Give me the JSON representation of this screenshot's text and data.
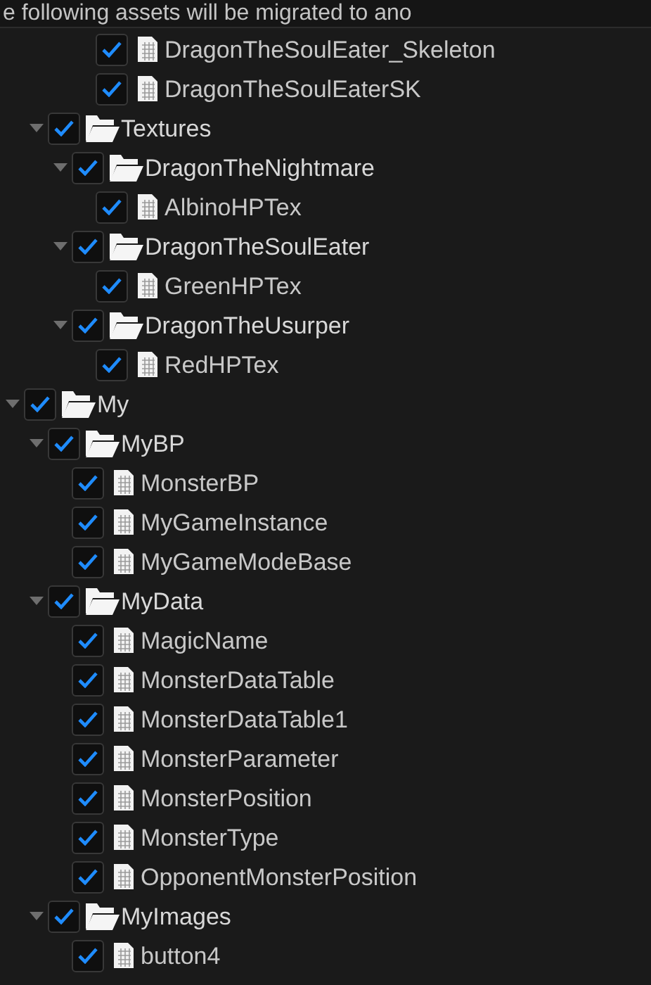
{
  "header": {
    "text": "e following assets will be migrated to ano"
  },
  "tree": [
    {
      "kind": "offscreen",
      "children": [
        {
          "kind": "offscreen",
          "children": [
            {
              "kind": "offscreen",
              "children": [
                {
                  "kind": "file",
                  "label": "DragonTheSoulEater_Skeleton",
                  "checked": true
                },
                {
                  "kind": "file",
                  "label": "DragonTheSoulEaterSK",
                  "checked": true
                }
              ]
            }
          ]
        },
        {
          "kind": "folder",
          "label": "Textures",
          "checked": true,
          "expanded": true,
          "children": [
            {
              "kind": "folder",
              "label": "DragonTheNightmare",
              "checked": true,
              "expanded": true,
              "children": [
                {
                  "kind": "file",
                  "label": "AlbinoHPTex",
                  "checked": true
                }
              ]
            },
            {
              "kind": "folder",
              "label": "DragonTheSoulEater",
              "checked": true,
              "expanded": true,
              "children": [
                {
                  "kind": "file",
                  "label": "GreenHPTex",
                  "checked": true
                }
              ]
            },
            {
              "kind": "folder",
              "label": "DragonTheUsurper",
              "checked": true,
              "expanded": true,
              "children": [
                {
                  "kind": "file",
                  "label": "RedHPTex",
                  "checked": true
                }
              ]
            }
          ]
        }
      ]
    },
    {
      "kind": "folder",
      "label": "My",
      "checked": true,
      "expanded": true,
      "children": [
        {
          "kind": "folder",
          "label": "MyBP",
          "checked": true,
          "expanded": true,
          "children": [
            {
              "kind": "file",
              "label": "MonsterBP",
              "checked": true
            },
            {
              "kind": "file",
              "label": "MyGameInstance",
              "checked": true
            },
            {
              "kind": "file",
              "label": "MyGameModeBase",
              "checked": true
            }
          ]
        },
        {
          "kind": "folder",
          "label": "MyData",
          "checked": true,
          "expanded": true,
          "children": [
            {
              "kind": "file",
              "label": "MagicName",
              "checked": true
            },
            {
              "kind": "file",
              "label": "MonsterDataTable",
              "checked": true
            },
            {
              "kind": "file",
              "label": "MonsterDataTable1",
              "checked": true
            },
            {
              "kind": "file",
              "label": "MonsterParameter",
              "checked": true
            },
            {
              "kind": "file",
              "label": "MonsterPosition",
              "checked": true
            },
            {
              "kind": "file",
              "label": "MonsterType",
              "checked": true
            },
            {
              "kind": "file",
              "label": "OpponentMonsterPosition",
              "checked": true
            }
          ]
        },
        {
          "kind": "folder",
          "label": "MyImages",
          "checked": true,
          "expanded": true,
          "children": [
            {
              "kind": "file",
              "label": "button4",
              "checked": true
            }
          ]
        }
      ]
    }
  ]
}
